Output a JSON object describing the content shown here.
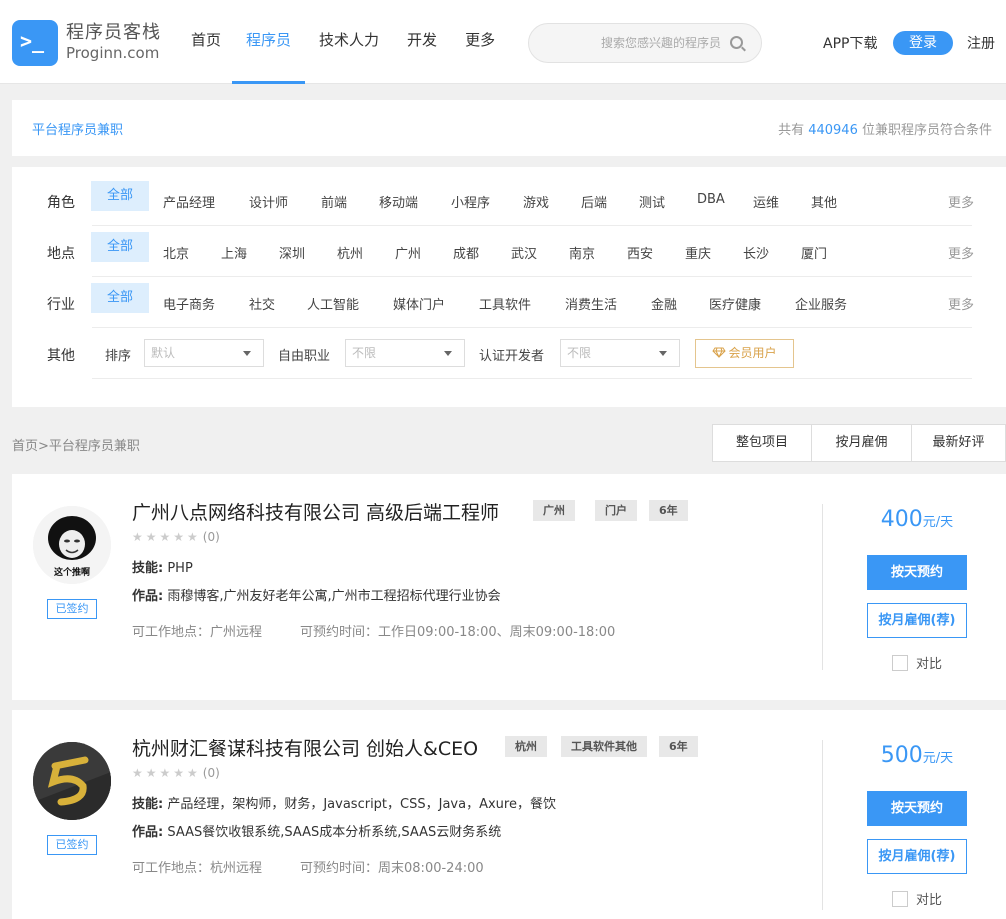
{
  "header": {
    "logo_cn": "程序员客栈",
    "logo_en": "Proginn.com",
    "logo_prompt": ">_",
    "nav": [
      "首页",
      "程序员",
      "技术人力",
      "开发",
      "更多"
    ],
    "nav_active": 1,
    "search_placeholder": "搜索您感兴趣的程序员",
    "app_download": "APP下载",
    "login": "登录",
    "register": "注册"
  },
  "info": {
    "left": "平台程序员兼职",
    "right_prefix": "共有 ",
    "count": "440946",
    "right_suffix": " 位兼职程序员符合条件"
  },
  "filters": {
    "role": {
      "label": "角色",
      "options": [
        "全部",
        "产品经理",
        "设计师",
        "前端",
        "移动端",
        "小程序",
        "游戏",
        "后端",
        "测试",
        "DBA",
        "运维",
        "其他"
      ],
      "more": "更多"
    },
    "location": {
      "label": "地点",
      "options": [
        "全部",
        "北京",
        "上海",
        "深圳",
        "杭州",
        "广州",
        "成都",
        "武汉",
        "南京",
        "西安",
        "重庆",
        "长沙",
        "厦门"
      ],
      "more": "更多"
    },
    "industry": {
      "label": "行业",
      "options": [
        "全部",
        "电子商务",
        "社交",
        "人工智能",
        "媒体门户",
        "工具软件",
        "消费生活",
        "金融",
        "医疗健康",
        "企业服务"
      ],
      "more": "更多"
    },
    "other": {
      "label": "其他",
      "sort_label": "排序",
      "sort_value": "默认",
      "freelance_label": "自由职业",
      "freelance_value": "不限",
      "certified_label": "认证开发者",
      "certified_value": "不限",
      "vip": "会员用户"
    }
  },
  "breadcrumb": "首页>平台程序员兼职",
  "sort_tabs": [
    "整包项目",
    "按月雇佣",
    "最新好评"
  ],
  "cards": [
    {
      "title": "广州八点网络科技有限公司  高级后端工程师",
      "tags": [
        "广州",
        "门户",
        "6年"
      ],
      "stars": "★★★★★",
      "rating_count": "(0)",
      "skills_label": "技能:",
      "skills": "PHP",
      "works_label": "作品:",
      "works": "雨穆博客,广州友好老年公寓,广州市工程招标代理行业协会",
      "location": "可工作地点：广州远程",
      "time": "可预约时间：工作日09:00-18:00、周末09:00-18:00",
      "signed": "已签约",
      "price": "400",
      "price_unit": "元/天",
      "btn_day": "按天预约",
      "btn_month": "按月雇佣(荐)",
      "compare": "对比",
      "avatar_caption": "这个推啊"
    },
    {
      "title": "杭州财汇餐谋科技有限公司  创始人&CEO",
      "tags": [
        "杭州",
        "工具软件其他",
        "6年"
      ],
      "stars": "★★★★★",
      "rating_count": "(0)",
      "skills_label": "技能:",
      "skills": "产品经理，架构师，财务，Javascript，CSS，Java，Axure，餐饮",
      "works_label": "作品:",
      "works": "SAAS餐饮收银系统,SAAS成本分析系统,SAAS云财务系统",
      "location": "可工作地点：杭州远程",
      "time": "可预约时间：周末08:00-24:00",
      "signed": "已签约",
      "price": "500",
      "price_unit": "元/天",
      "btn_day": "按天预约",
      "btn_month": "按月雇佣(荐)",
      "compare": "对比"
    }
  ]
}
